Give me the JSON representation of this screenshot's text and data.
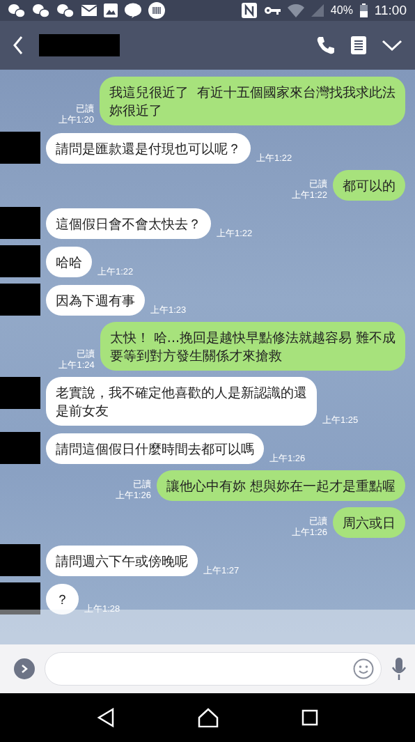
{
  "status_bar": {
    "battery": "40%",
    "time": "11:00"
  },
  "messages": [
    {
      "kind": "outgoing",
      "lines": [
        "我這兒很近了  有近十五個國家來台灣找我求此法",
        "妳很近了"
      ],
      "read": "已讀",
      "time": "上午1:20"
    },
    {
      "kind": "incoming",
      "lines": [
        "請問是匯款還是付現也可以呢？"
      ],
      "time": "上午1:22"
    },
    {
      "kind": "outgoing",
      "lines": [
        "都可以的"
      ],
      "read": "已讀",
      "time": "上午1:22"
    },
    {
      "kind": "incoming",
      "lines": [
        "這個假日會不會太快去？"
      ],
      "time": "上午1:22"
    },
    {
      "kind": "incoming",
      "lines": [
        "哈哈"
      ],
      "time": "上午1:22"
    },
    {
      "kind": "incoming",
      "lines": [
        "因為下週有事"
      ],
      "time": "上午1:23"
    },
    {
      "kind": "outgoing",
      "lines": [
        "太快！ 哈...挽回是越快早點修法就越容易 難不成",
        "要等到對方發生關係才來搶救"
      ],
      "read": "已讀",
      "time": "上午1:24"
    },
    {
      "kind": "incoming",
      "lines": [
        "老實說，我不確定他喜歡的人是新認識的還",
        "是前女友"
      ],
      "time": "上午1:25"
    },
    {
      "kind": "incoming",
      "lines": [
        "請問這個假日什麼時間去都可以嗎"
      ],
      "time": "上午1:26"
    },
    {
      "kind": "outgoing",
      "lines": [
        "讓他心中有妳 想與妳在一起才是重點喔"
      ],
      "read": "已讀",
      "time": "上午1:26"
    },
    {
      "kind": "outgoing",
      "lines": [
        "周六或日"
      ],
      "read": "已讀",
      "time": "上午1:26"
    },
    {
      "kind": "incoming",
      "lines": [
        "請問週六下午或傍晚呢"
      ],
      "time": "上午1:27"
    },
    {
      "kind": "incoming",
      "lines": [
        "？"
      ],
      "time": "上午1:28"
    }
  ]
}
